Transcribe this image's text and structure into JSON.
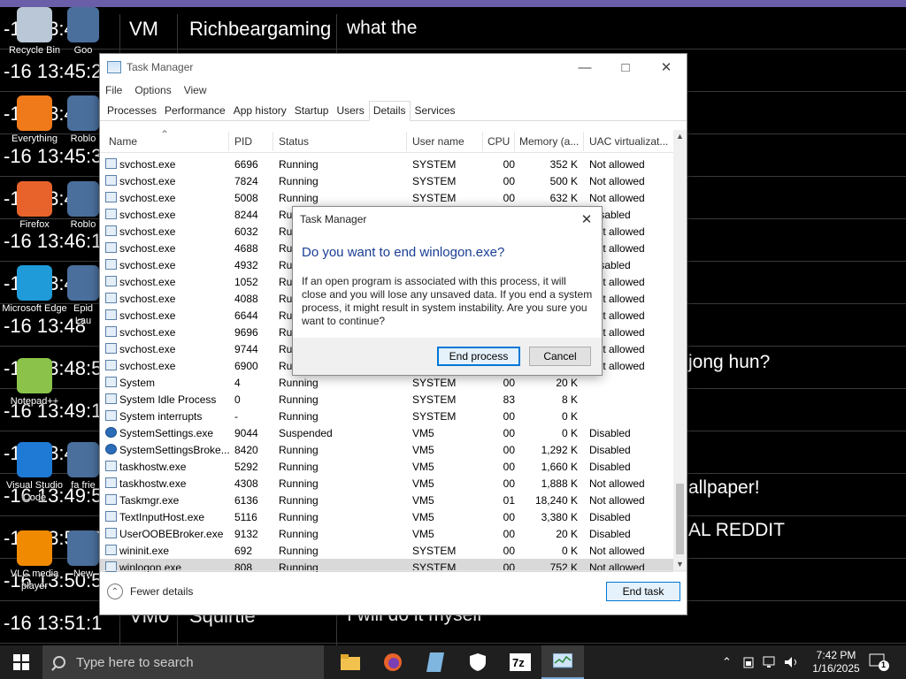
{
  "chat": {
    "rows": [
      {
        "ts": "-16 13:44",
        "user": "Richbeargaming",
        "msg": "what the"
      },
      {
        "ts": "-16 13:45:2"
      },
      {
        "ts": "-16 13:45:"
      },
      {
        "ts": "-16 13:45:3"
      },
      {
        "ts": "-16 13:45:"
      },
      {
        "ts": "-16 13:46:1"
      },
      {
        "ts": "-16 13:47:"
      },
      {
        "ts": "-16 13:48"
      },
      {
        "ts": "-16 13:48:5"
      },
      {
        "ts": "-16 13:49:1"
      },
      {
        "ts": "-16 13:49:3"
      },
      {
        "ts": "-16 13:49:5"
      },
      {
        "ts": "-16 13:50:3"
      },
      {
        "ts": "-16 13:50:5"
      },
      {
        "ts": "-16 13:51:1",
        "user": "Squirtle",
        "msg": "I will do it myself"
      }
    ],
    "vm_label": "VM",
    "vm_label_2": "VM0",
    "partial_1": "jong hun?",
    "partial_2": "allpaper!",
    "partial_3": "AL REDDIT"
  },
  "desktop_icons": [
    {
      "label": "Recycle Bin",
      "color": "#b9c7d6"
    },
    {
      "label": "Everything",
      "color": "#f07a1a"
    },
    {
      "label": "Firefox",
      "color": "#e8632b"
    },
    {
      "label": "Microsoft Edge",
      "color": "#1f9bd9"
    },
    {
      "label": "Notepad++",
      "color": "#8bc34a"
    },
    {
      "label": "Visual Studio Code",
      "color": "#1f7ad6"
    },
    {
      "label": "VLC media player",
      "color": "#f08a00"
    }
  ],
  "desktop_icons_col2": [
    "Goo",
    "Roblo",
    "Roblo",
    "Epid Lau",
    "fa frie",
    "New"
  ],
  "taskmgr": {
    "title": "Task Manager",
    "menu": [
      "File",
      "Options",
      "View"
    ],
    "tabs": [
      "Processes",
      "Performance",
      "App history",
      "Startup",
      "Users",
      "Details",
      "Services"
    ],
    "active_tab": "Details",
    "columns": [
      "Name",
      "PID",
      "Status",
      "User name",
      "CPU",
      "Memory (a...",
      "UAC virtualizat..."
    ],
    "rows": [
      [
        "svchost.exe",
        "6696",
        "Running",
        "SYSTEM",
        "00",
        "352 K",
        "Not allowed"
      ],
      [
        "svchost.exe",
        "7824",
        "Running",
        "SYSTEM",
        "00",
        "500 K",
        "Not allowed"
      ],
      [
        "svchost.exe",
        "5008",
        "Running",
        "SYSTEM",
        "00",
        "632 K",
        "Not allowed"
      ],
      [
        "svchost.exe",
        "8244",
        "Ru",
        "",
        "",
        "",
        "Disabled"
      ],
      [
        "svchost.exe",
        "6032",
        "Ru",
        "",
        "",
        "",
        "Not allowed"
      ],
      [
        "svchost.exe",
        "4688",
        "Ru",
        "",
        "",
        "",
        "Not allowed"
      ],
      [
        "svchost.exe",
        "4932",
        "Ru",
        "",
        "",
        "",
        "Disabled"
      ],
      [
        "svchost.exe",
        "1052",
        "Ru",
        "",
        "",
        "",
        "Not allowed"
      ],
      [
        "svchost.exe",
        "4088",
        "Ru",
        "",
        "",
        "",
        "Not allowed"
      ],
      [
        "svchost.exe",
        "6644",
        "Ru",
        "",
        "",
        "",
        "Not allowed"
      ],
      [
        "svchost.exe",
        "9696",
        "Ru",
        "",
        "",
        "",
        "Not allowed"
      ],
      [
        "svchost.exe",
        "9744",
        "Ru",
        "",
        "",
        "",
        "Not allowed"
      ],
      [
        "svchost.exe",
        "6900",
        "Ru",
        "",
        "",
        "",
        "Not allowed"
      ],
      [
        "System",
        "4",
        "Running",
        "SYSTEM",
        "00",
        "20 K",
        ""
      ],
      [
        "System Idle Process",
        "0",
        "Running",
        "SYSTEM",
        "83",
        "8 K",
        ""
      ],
      [
        "System interrupts",
        "-",
        "Running",
        "SYSTEM",
        "00",
        "0 K",
        ""
      ],
      [
        "SystemSettings.exe",
        "9044",
        "Suspended",
        "VM5",
        "00",
        "0 K",
        "Disabled"
      ],
      [
        "SystemSettingsBroke...",
        "8420",
        "Running",
        "VM5",
        "00",
        "1,292 K",
        "Disabled"
      ],
      [
        "taskhostw.exe",
        "5292",
        "Running",
        "VM5",
        "00",
        "1,660 K",
        "Disabled"
      ],
      [
        "taskhostw.exe",
        "4308",
        "Running",
        "VM5",
        "00",
        "1,888 K",
        "Not allowed"
      ],
      [
        "Taskmgr.exe",
        "6136",
        "Running",
        "VM5",
        "01",
        "18,240 K",
        "Not allowed"
      ],
      [
        "TextInputHost.exe",
        "5116",
        "Running",
        "VM5",
        "00",
        "3,380 K",
        "Disabled"
      ],
      [
        "UserOOBEBroker.exe",
        "9132",
        "Running",
        "VM5",
        "00",
        "20 K",
        "Disabled"
      ],
      [
        "wininit.exe",
        "692",
        "Running",
        "SYSTEM",
        "00",
        "0 K",
        "Not allowed"
      ],
      [
        "winlogon.exe",
        "808",
        "Running",
        "SYSTEM",
        "00",
        "752 K",
        "Not allowed"
      ]
    ],
    "selected_row": 24,
    "fewer_details": "Fewer details",
    "end_task": "End task"
  },
  "dialog": {
    "title": "Task Manager",
    "question": "Do you want to end winlogon.exe?",
    "body": "If an open program is associated with this process, it will close and you will lose any unsaved data. If you end a system process, it might result in system instability. Are you sure you want to continue?",
    "end_process": "End process",
    "cancel": "Cancel"
  },
  "taskbar": {
    "search_placeholder": "Type here to search",
    "time": "7:42 PM",
    "date": "1/16/2025",
    "notification_count": "1"
  }
}
